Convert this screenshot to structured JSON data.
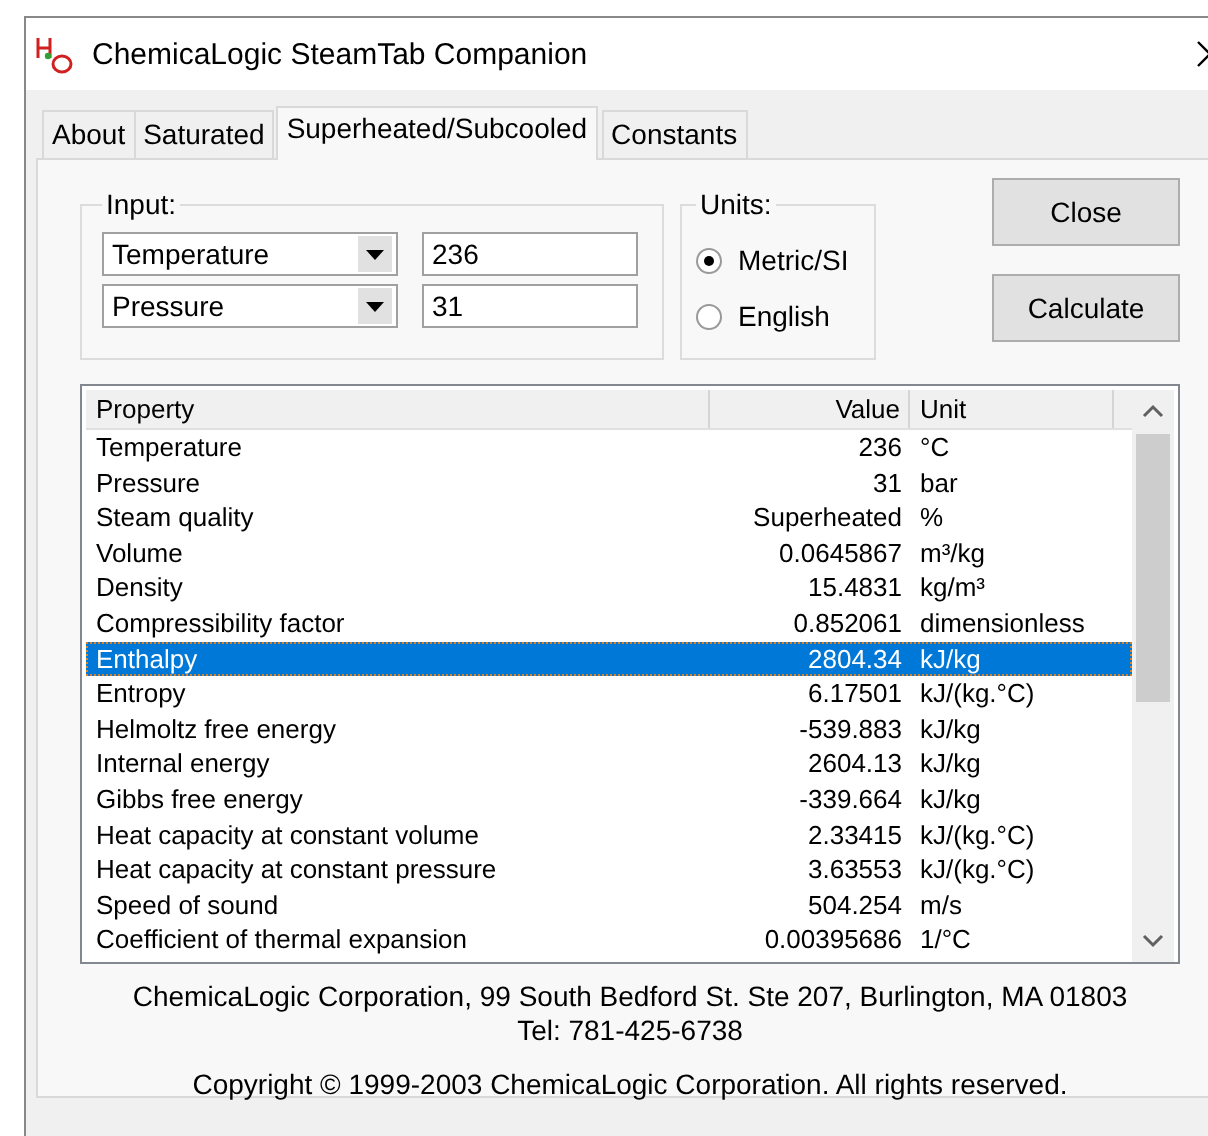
{
  "window": {
    "title": "ChemicaLogic SteamTab Companion"
  },
  "tabs": [
    {
      "label": "About",
      "selected": false
    },
    {
      "label": "Saturated",
      "selected": false
    },
    {
      "label": "Superheated/Subcooled",
      "selected": true
    },
    {
      "label": "Constants",
      "selected": false
    }
  ],
  "input": {
    "label": "Input:",
    "rows": [
      {
        "parameter": "Temperature",
        "value": "236"
      },
      {
        "parameter": "Pressure",
        "value": "31"
      }
    ]
  },
  "units": {
    "label": "Units:",
    "options": [
      {
        "label": "Metric/SI",
        "selected": true
      },
      {
        "label": "English",
        "selected": false
      }
    ]
  },
  "buttons": [
    "Close",
    "Calculate"
  ],
  "table": {
    "columns": [
      "Property",
      "Value",
      "Unit"
    ],
    "rows": [
      {
        "property": "Temperature",
        "value": "236",
        "unit": "°C",
        "selected": false
      },
      {
        "property": "Pressure",
        "value": "31",
        "unit": "bar",
        "selected": false
      },
      {
        "property": "Steam quality",
        "value": "Superheated",
        "unit": "%",
        "selected": false
      },
      {
        "property": "Volume",
        "value": "0.0645867",
        "unit": "m³/kg",
        "selected": false
      },
      {
        "property": "Density",
        "value": "15.4831",
        "unit": "kg/m³",
        "selected": false
      },
      {
        "property": "Compressibility factor",
        "value": "0.852061",
        "unit": "dimensionless",
        "selected": false
      },
      {
        "property": "Enthalpy",
        "value": "2804.34",
        "unit": "kJ/kg",
        "selected": true
      },
      {
        "property": "Entropy",
        "value": "6.17501",
        "unit": "kJ/(kg.°C)",
        "selected": false
      },
      {
        "property": "Helmoltz free energy",
        "value": "-539.883",
        "unit": "kJ/kg",
        "selected": false
      },
      {
        "property": "Internal energy",
        "value": "2604.13",
        "unit": "kJ/kg",
        "selected": false
      },
      {
        "property": "Gibbs free energy",
        "value": "-339.664",
        "unit": "kJ/kg",
        "selected": false
      },
      {
        "property": "Heat capacity at constant volume",
        "value": "2.33415",
        "unit": "kJ/(kg.°C)",
        "selected": false
      },
      {
        "property": "Heat capacity at constant pressure",
        "value": "3.63553",
        "unit": "kJ/(kg.°C)",
        "selected": false
      },
      {
        "property": "Speed of sound",
        "value": "504.254",
        "unit": "m/s",
        "selected": false
      },
      {
        "property": "Coefficient of thermal expansion",
        "value": "0.00395686",
        "unit": "1/°C",
        "selected": false
      }
    ]
  },
  "footer": {
    "address": "ChemicaLogic Corporation, 99 South Bedford St. Ste 207, Burlington, MA 01803 Tel: 781-425-6738",
    "copyright": "Copyright © 1999-2003 ChemicaLogic Corporation. All rights reserved."
  }
}
